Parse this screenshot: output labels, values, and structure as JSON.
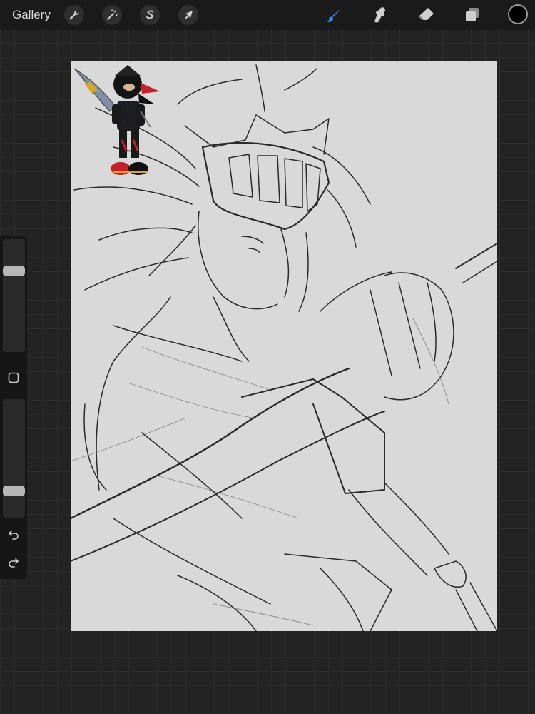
{
  "toolbar": {
    "gallery_label": "Gallery",
    "left_tools": [
      {
        "name": "actions",
        "icon": "wrench-icon"
      },
      {
        "name": "adjustments",
        "icon": "magic-wand-icon"
      },
      {
        "name": "selection",
        "icon": "selection-s-icon"
      },
      {
        "name": "transform",
        "icon": "arrow-cursor-icon"
      }
    ],
    "right_tools": [
      {
        "name": "brush",
        "icon": "brush-icon",
        "active": true
      },
      {
        "name": "smudge",
        "icon": "smudge-icon",
        "active": false
      },
      {
        "name": "eraser",
        "icon": "eraser-icon",
        "active": false
      },
      {
        "name": "layers",
        "icon": "layers-icon",
        "active": false
      }
    ],
    "current_color": "#000000",
    "accent_color": "#2f8cf6"
  },
  "sidebar": {
    "brush_size_level": 0.74,
    "opacity_level": 0.2,
    "modify_button_icon": "square-icon",
    "undo_icon": "undo-icon",
    "redo_icon": "redo-icon"
  },
  "canvas": {
    "background_color": "#d9d9d9",
    "content": "sketch-drawing",
    "reference_image": "character-reference"
  }
}
